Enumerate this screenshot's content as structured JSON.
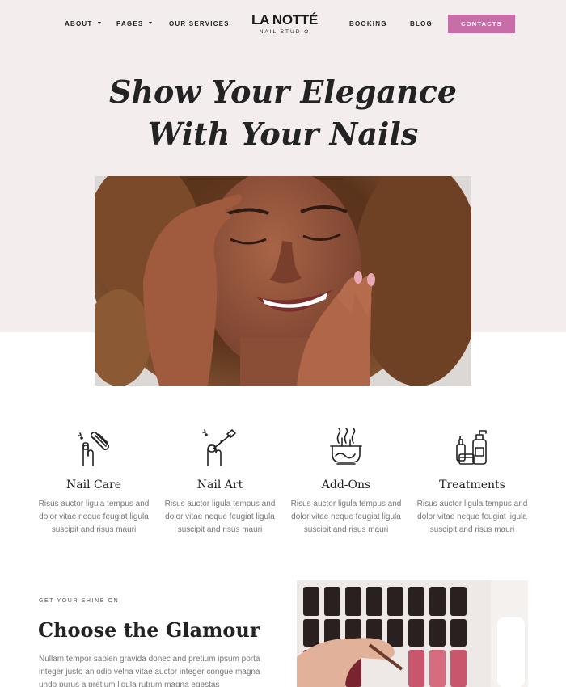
{
  "nav": {
    "about": "About",
    "pages": "Pages",
    "services": "Our Services",
    "booking": "Booking",
    "blog": "Blog",
    "contacts": "Contacts"
  },
  "logo": {
    "main": "LA NOTTÉ",
    "sub": "NAIL STUDIO"
  },
  "hero": {
    "title_line1": "Show Your Elegance",
    "title_line2": "With Your Nails"
  },
  "features": [
    {
      "icon": "nail-file-icon",
      "title": "Nail Care",
      "text": "Risus auctor ligula tempus and dolor vitae neque feugiat ligula suscipit and risus mauri"
    },
    {
      "icon": "nail-polish-brush-icon",
      "title": "Nail Art",
      "text": "Risus auctor ligula tempus and dolor vitae neque feugiat ligula suscipit and risus mauri"
    },
    {
      "icon": "soak-bowl-icon",
      "title": "Add-Ons",
      "text": "Risus auctor ligula tempus and dolor vitae neque feugiat ligula suscipit and risus mauri"
    },
    {
      "icon": "cosmetic-bottles-icon",
      "title": "Treatments",
      "text": "Risus auctor ligula tempus and dolor vitae neque feugiat ligula suscipit and risus mauri"
    }
  ],
  "section2": {
    "eyebrow": "Get your shine on",
    "title": "Choose the Glamour",
    "text": "Nullam tempor sapien gravida donec and pretium ipsum porta integer justo an odio velna vitae auctor integer congue magna undo purus a pretium ligula rutrum magna egestas"
  },
  "colors": {
    "accent": "#c76ea7",
    "hero_bg": "#f4eded"
  }
}
